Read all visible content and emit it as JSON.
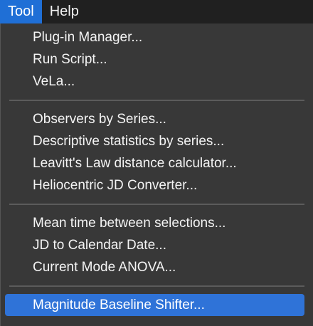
{
  "menubar": {
    "items": [
      {
        "label": "Tool"
      },
      {
        "label": "Help"
      }
    ]
  },
  "menu": {
    "groups": [
      {
        "items": [
          {
            "label": "Plug-in Manager..."
          },
          {
            "label": "Run Script..."
          },
          {
            "label": "VeLa..."
          }
        ]
      },
      {
        "items": [
          {
            "label": "Observers by Series..."
          },
          {
            "label": "Descriptive statistics by series..."
          },
          {
            "label": "Leavitt's Law distance calculator..."
          },
          {
            "label": "Heliocentric JD Converter..."
          }
        ]
      },
      {
        "items": [
          {
            "label": "Mean time between selections..."
          },
          {
            "label": "JD to Calendar Date..."
          },
          {
            "label": "Current Mode ANOVA..."
          }
        ]
      },
      {
        "items": [
          {
            "label": "Magnitude Baseline Shifter...",
            "highlighted": true
          }
        ]
      }
    ]
  },
  "colors": {
    "menubar_bg": "#202020",
    "menu_bg": "#383838",
    "accent": "#2f73d8",
    "text": "#f4f4f4"
  }
}
